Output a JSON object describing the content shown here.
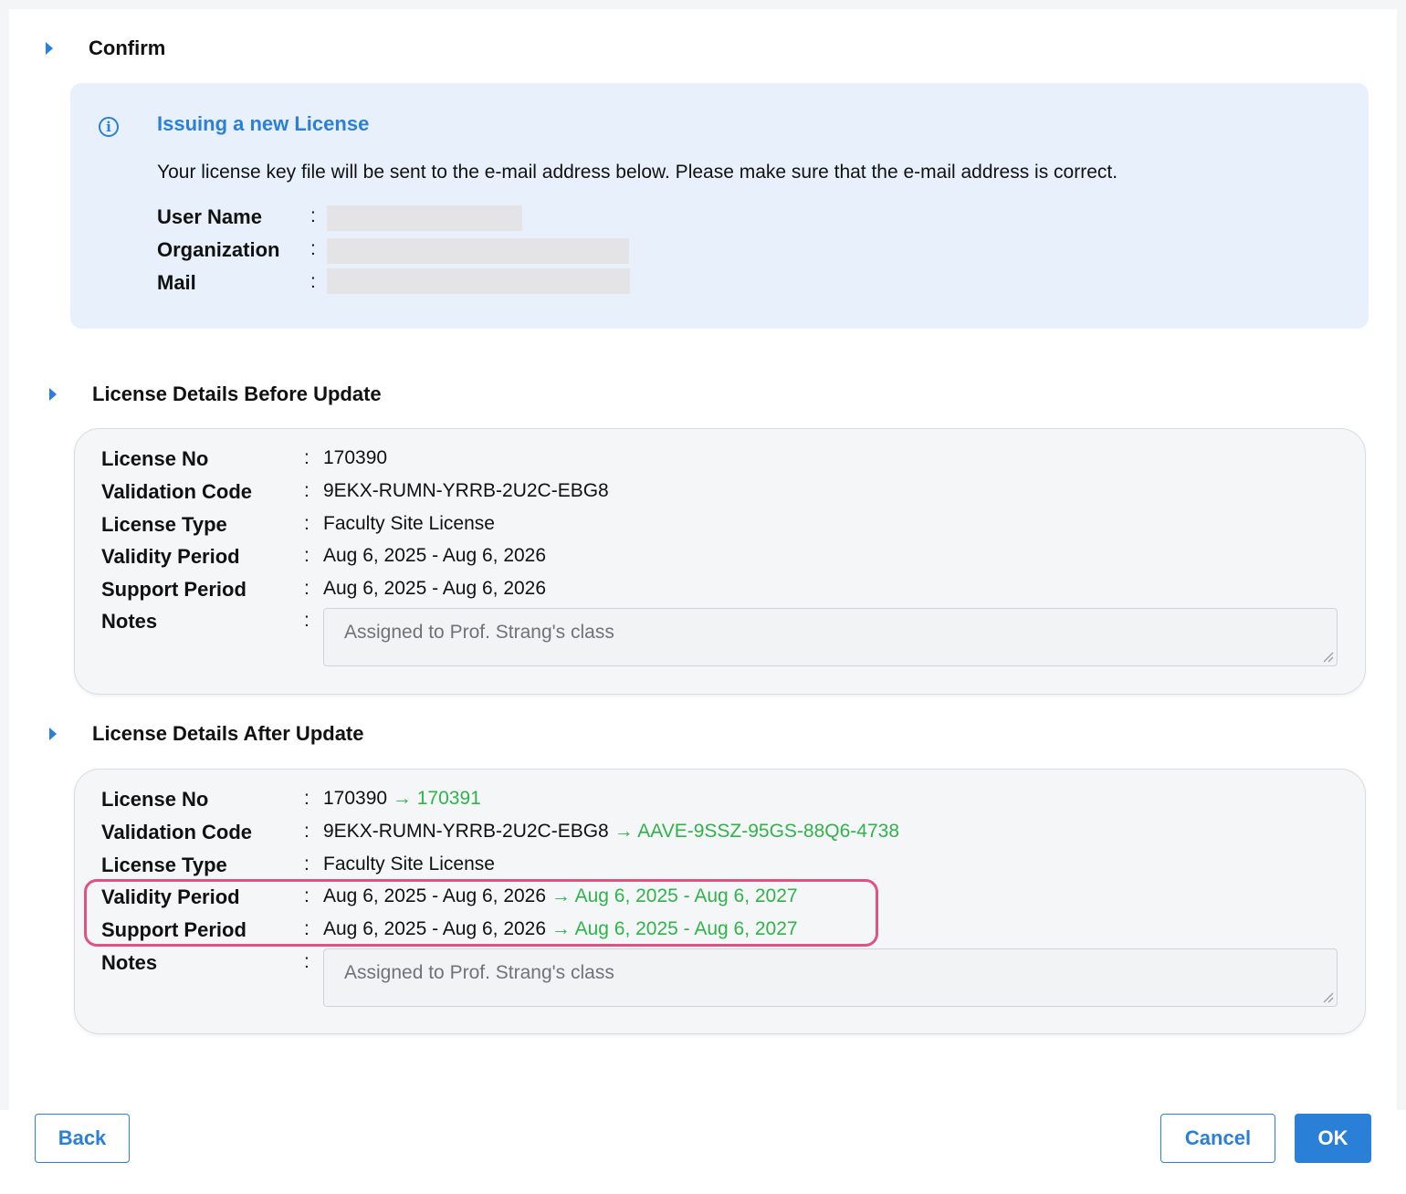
{
  "sections": {
    "confirm": {
      "title": "Confirm"
    },
    "before": {
      "title": "License Details Before Update"
    },
    "after": {
      "title": "License Details After Update"
    }
  },
  "info": {
    "title": "Issuing a new License",
    "description": "Your license key file will be sent to the e-mail address below. Please make sure that the e-mail address is correct.",
    "fields": [
      {
        "label": "User Name"
      },
      {
        "label": "Organization"
      },
      {
        "label": "Mail"
      }
    ],
    "separator": ":"
  },
  "before": {
    "rows": [
      {
        "label": "License No",
        "value": "170390"
      },
      {
        "label": "Validation Code",
        "value": "9EKX-RUMN-YRRB-2U2C-EBG8"
      },
      {
        "label": "License Type",
        "value": "Faculty Site License"
      },
      {
        "label": "Validity Period",
        "value": "Aug 6, 2025 - Aug 6, 2026"
      },
      {
        "label": "Support Period",
        "value": "Aug 6, 2025 - Aug 6, 2026"
      }
    ],
    "notes_label": "Notes",
    "notes_value": "Assigned to Prof. Strang's class"
  },
  "after": {
    "rows": [
      {
        "label": "License No",
        "old": "170390",
        "new": "→ 170391"
      },
      {
        "label": "Validation Code",
        "old": "9EKX-RUMN-YRRB-2U2C-EBG8",
        "new": "→ AAVE-9SSZ-95GS-88Q6-4738"
      },
      {
        "label": "License Type",
        "old": "Faculty Site License",
        "new": ""
      },
      {
        "label": "Validity Period",
        "old": "Aug 6, 2025 - Aug 6, 2026",
        "new": "→ Aug 6, 2025 - Aug 6, 2027"
      },
      {
        "label": "Support Period",
        "old": "Aug 6, 2025 - Aug 6, 2026",
        "new": "→ Aug 6, 2025 - Aug 6, 2027"
      }
    ],
    "notes_label": "Notes",
    "notes_value": "Assigned to Prof. Strang's class"
  },
  "buttons": {
    "back": "Back",
    "cancel": "Cancel",
    "ok": "OK"
  },
  "colors": {
    "accent": "#2a7fd6",
    "changed_value": "#2fb34a",
    "highlight_border": "#e0527f"
  }
}
